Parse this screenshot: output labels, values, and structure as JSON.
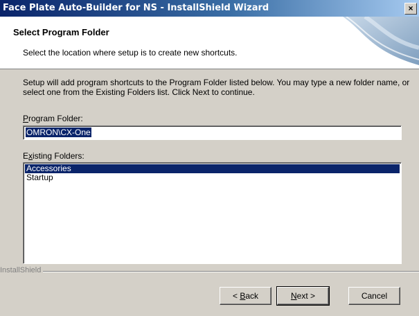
{
  "window": {
    "title": "Face Plate Auto-Builder for NS - InstallShield Wizard",
    "close_glyph": "×"
  },
  "header": {
    "title": "Select Program Folder",
    "subtitle": "Select the location where setup is to create new shortcuts."
  },
  "main": {
    "description": "Setup will add program shortcuts to the Program Folder listed below. You may type a new folder name, or select one from the Existing Folders list.  Click Next to continue.",
    "program_folder_label_mnemonic": "P",
    "program_folder_label_rest": "rogram Folder:",
    "program_folder_value": "OMRON\\CX-One",
    "existing_label_pre": "E",
    "existing_label_mnemonic": "x",
    "existing_label_rest": "isting Folders:",
    "existing_folders": [
      "Accessories",
      "Startup"
    ],
    "selected_index": 0
  },
  "footer": {
    "brand": "InstallShield",
    "back_pre": "< ",
    "back_mnemonic": "B",
    "back_rest": "ack",
    "next_mnemonic": "N",
    "next_rest": "ext >",
    "cancel_label": "Cancel"
  },
  "colors": {
    "title_bar": "#0a246a",
    "selection": "#0a246a",
    "face": "#d4d0c8"
  }
}
